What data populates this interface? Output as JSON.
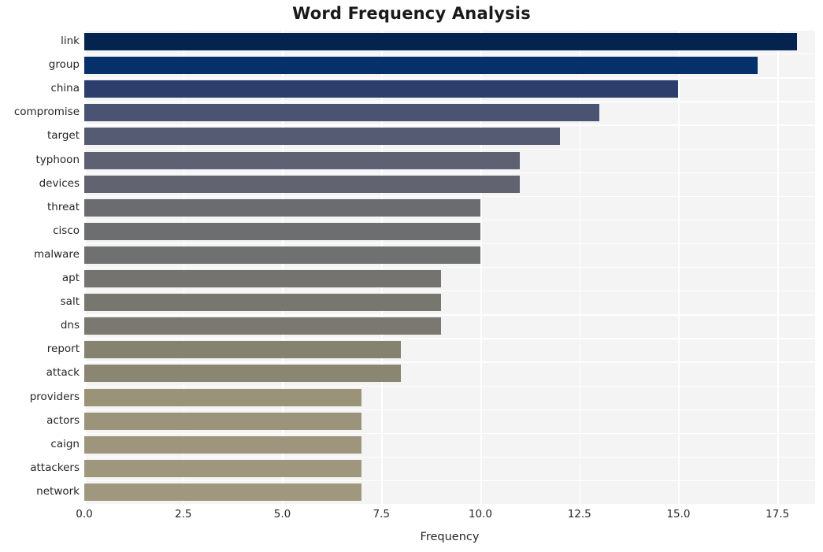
{
  "chart_data": {
    "type": "bar",
    "orientation": "horizontal",
    "title": "Word Frequency Analysis",
    "xlabel": "Frequency",
    "ylabel": "",
    "categories": [
      "link",
      "group",
      "china",
      "compromise",
      "target",
      "typhoon",
      "devices",
      "threat",
      "cisco",
      "malware",
      "apt",
      "salt",
      "dns",
      "report",
      "attack",
      "providers",
      "actors",
      "caign",
      "attackers",
      "network"
    ],
    "values": [
      18,
      17,
      15,
      13,
      12,
      11,
      11,
      10,
      10,
      10,
      9,
      9,
      9,
      8,
      8,
      7,
      7,
      7,
      7,
      7
    ],
    "bar_colors": [
      "#04244f",
      "#063069",
      "#2d3e6c",
      "#4b5372",
      "#565b74",
      "#5d6172",
      "#616470",
      "#6a6c6f",
      "#6d6e6f",
      "#6f7070",
      "#74736f",
      "#77766f",
      "#7a7871",
      "#85826f",
      "#8a8671",
      "#9a9378",
      "#9b947a",
      "#9d967c",
      "#9e977d",
      "#9f987e"
    ],
    "xlim": [
      0,
      18.45
    ],
    "ylim_count": 20,
    "xticks": [
      0.0,
      2.5,
      5.0,
      7.5,
      10.0,
      12.5,
      15.0,
      17.5
    ],
    "xtick_labels": [
      "0.0",
      "2.5",
      "5.0",
      "7.5",
      "10.0",
      "12.5",
      "15.0",
      "17.5"
    ],
    "grid": true,
    "grid_color": "#ffffff",
    "plot_background": "#f4f4f5",
    "figure_background": "#ffffff",
    "legend": null,
    "legend_position": "none"
  }
}
